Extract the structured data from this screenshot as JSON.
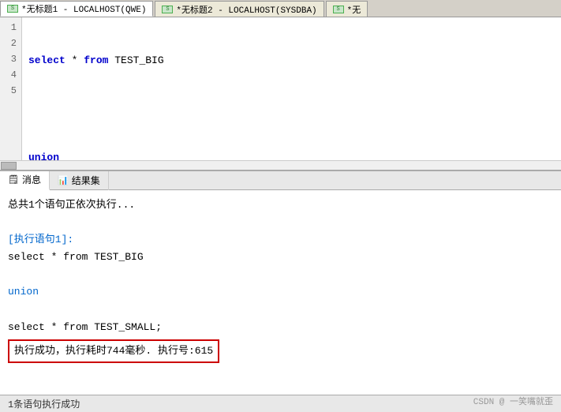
{
  "tabs": [
    {
      "id": "tab1",
      "label": "*无标题1 - LOCALHOST(QWE)",
      "active": true
    },
    {
      "id": "tab2",
      "label": "*无标题2 - LOCALHOST(SYSDBA)",
      "active": false
    },
    {
      "id": "tab3",
      "label": "*无",
      "active": false,
      "truncated": true
    }
  ],
  "editor": {
    "lines": [
      {
        "num": 1,
        "content": "select * from TEST_BIG",
        "highlight": false
      },
      {
        "num": 2,
        "content": "",
        "highlight": false
      },
      {
        "num": 3,
        "content": "union",
        "highlight": false
      },
      {
        "num": 4,
        "content": "",
        "highlight": false
      },
      {
        "num": 5,
        "content": "select * from TEST_SMALL;",
        "highlight": true
      }
    ]
  },
  "bottom_tabs": [
    {
      "id": "messages",
      "label": "消息",
      "active": true,
      "icon": "📋"
    },
    {
      "id": "results",
      "label": "结果集",
      "active": false,
      "icon": "📊"
    }
  ],
  "messages": {
    "status_line": "总共1个语句正依次执行...",
    "exec_header": "[执行语句1]:",
    "query1": "select * from TEST_BIG",
    "union_line": "union",
    "query2": "select * from TEST_SMALL;",
    "success_text": "执行成功，执行耗时744毫秒. 执行号:615",
    "footer_text": "1条语句执行成功"
  },
  "watermark": "CSDN @ 一笑嘴就歪"
}
